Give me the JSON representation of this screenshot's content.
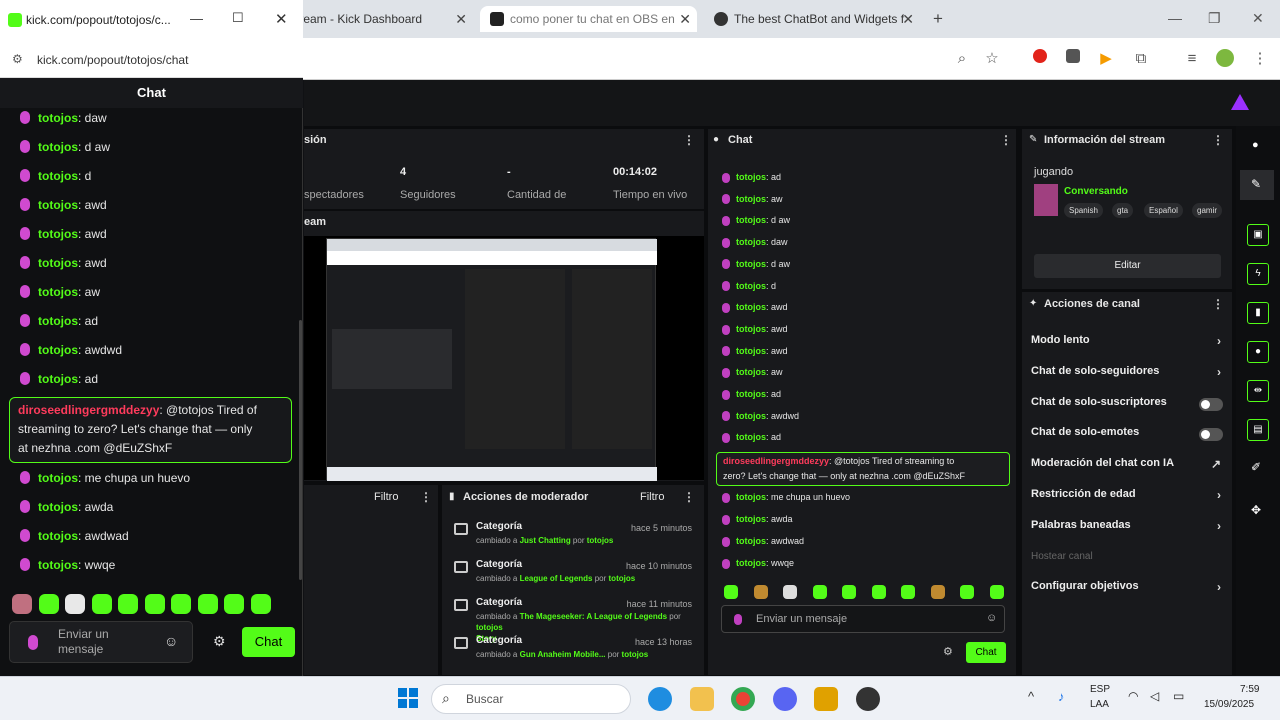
{
  "popout": {
    "window_title": "kick.com/popout/totojos/c...",
    "url": "kick.com/popout/totojos/chat",
    "chat_header": "Chat",
    "messages_top": [
      {
        "user": "totojos",
        "text": ": daw"
      },
      {
        "user": "totojos",
        "text": ": d aw"
      },
      {
        "user": "totojos",
        "text": ": d"
      },
      {
        "user": "totojos",
        "text": ": awd"
      },
      {
        "user": "totojos",
        "text": ": awd"
      },
      {
        "user": "totojos",
        "text": ": awd"
      },
      {
        "user": "totojos",
        "text": ": aw"
      },
      {
        "user": "totojos",
        "text": ": ad"
      },
      {
        "user": "totojos",
        "text": ": awdwd"
      },
      {
        "user": "totojos",
        "text": ": ad"
      }
    ],
    "spam": {
      "user": "diroseedlingergmddezyy",
      "text_line1": ": @totojos Tired of",
      "text_line2": "streaming to zero? Let's change that — only",
      "text_line3": "at nezhna .com @dEuZShxF"
    },
    "messages_bottom": [
      {
        "user": "totojos",
        "text": ": me chupa un huevo"
      },
      {
        "user": "totojos",
        "text": ": awda"
      },
      {
        "user": "totojos",
        "text": ": awdwad"
      },
      {
        "user": "totojos",
        "text": ": wwqe"
      }
    ],
    "input_placeholder_1": "Enviar un",
    "input_placeholder_2": "mensaje",
    "send_label": "Chat"
  },
  "tabs": [
    {
      "label": "Stream - Kick Dashboard"
    },
    {
      "label": "como poner tu chat en OBS en"
    },
    {
      "label": "The best ChatBot and Widgets f"
    }
  ],
  "dashboard": {
    "session_title": "sión",
    "stats": [
      {
        "value": "",
        "label": "spectadores"
      },
      {
        "value": "4",
        "label": "Seguidores"
      },
      {
        "value": "-",
        "label": "Cantidad de"
      },
      {
        "value": "00:14:02",
        "label": "Tiempo en vivo"
      }
    ],
    "stream_label": "eam",
    "filtro_left": "Filtro",
    "mod_actions_title": "Acciones de moderador",
    "filtro_right": "Filtro",
    "mod_actions": [
      {
        "title": "Categoría",
        "time": "hace 5 minutos",
        "prefix": "cambiado a ",
        "cat": "Just Chatting",
        "by": " por ",
        "user": "totojos",
        "desc2": ""
      },
      {
        "title": "Categoría",
        "time": "hace 10 minutos",
        "prefix": "cambiado a ",
        "cat": "League of Legends",
        "by": " por ",
        "user": "totojos",
        "desc2": ""
      },
      {
        "title": "Categoría",
        "time": "hace 11 minutos",
        "prefix": "cambiado a ",
        "cat": "The Mageseeker: A League of Legends",
        "by": " por ",
        "user": "totojos",
        "desc2": "Story"
      },
      {
        "title": "Categoría",
        "time": "hace 13 horas",
        "prefix": "cambiado a ",
        "cat": "Gun Anaheim Mobile...",
        "by": " por ",
        "user": "totojos",
        "desc2": ""
      }
    ],
    "chat_title": "Chat",
    "chat_lines": [
      {
        "user": "totojos",
        "text": ": ad"
      },
      {
        "user": "totojos",
        "text": ": aw"
      },
      {
        "user": "totojos",
        "text": ": d aw"
      },
      {
        "user": "totojos",
        "text": ": daw"
      },
      {
        "user": "totojos",
        "text": ": d aw"
      },
      {
        "user": "totojos",
        "text": ": d"
      },
      {
        "user": "totojos",
        "text": ": awd"
      },
      {
        "user": "totojos",
        "text": ": awd"
      },
      {
        "user": "totojos",
        "text": ": awd"
      },
      {
        "user": "totojos",
        "text": ": aw"
      },
      {
        "user": "totojos",
        "text": ": ad"
      },
      {
        "user": "totojos",
        "text": ": awdwd"
      },
      {
        "user": "totojos",
        "text": ": ad"
      }
    ],
    "chat_spam": {
      "user": "diroseedlingergmddezyy",
      "line1": ": @totojos Tired of streaming to",
      "line2": "zero? Let's change that — only at nezhna .com @dEuZShxF"
    },
    "chat_lines_after": [
      {
        "user": "totojos",
        "text": ": me chupa un huevo"
      },
      {
        "user": "totojos",
        "text": ": awda"
      },
      {
        "user": "totojos",
        "text": ": awdwad"
      },
      {
        "user": "totojos",
        "text": ": wwqe"
      }
    ],
    "chat_input_placeholder": "Enviar un mensaje",
    "chat_send": "Chat",
    "info_title": "Información del stream",
    "playing_label": "jugando",
    "category": "Conversando",
    "tags": [
      "Spanish",
      "gta",
      "Español",
      "gamir"
    ],
    "edit_label": "Editar",
    "canal_title": "Acciones de canal",
    "canal_items": [
      {
        "label": "Modo lento",
        "kind": "chevron"
      },
      {
        "label": "Chat de solo-seguidores",
        "kind": "chevron"
      },
      {
        "label": "Chat de solo-suscriptores",
        "kind": "toggle"
      },
      {
        "label": "Chat de solo-emotes",
        "kind": "toggle"
      },
      {
        "label": "Moderación del chat con IA",
        "kind": "ext"
      },
      {
        "label": "Restricción de edad",
        "kind": "chevron"
      },
      {
        "label": "Palabras baneadas",
        "kind": "chevron"
      },
      {
        "label": "Hostear canal",
        "kind": "disabled"
      },
      {
        "label": "Configurar objetivos",
        "kind": "chevron"
      }
    ]
  },
  "taskbar": {
    "search_placeholder": "Buscar",
    "lang_line1": "ESP",
    "lang_line2": "LAA",
    "time": "7:59",
    "date": "15/09/2025"
  },
  "colors": {
    "kick_green": "#53fc18",
    "user_pink": "#d04ad0",
    "spam_red": "#ff3b5c"
  }
}
